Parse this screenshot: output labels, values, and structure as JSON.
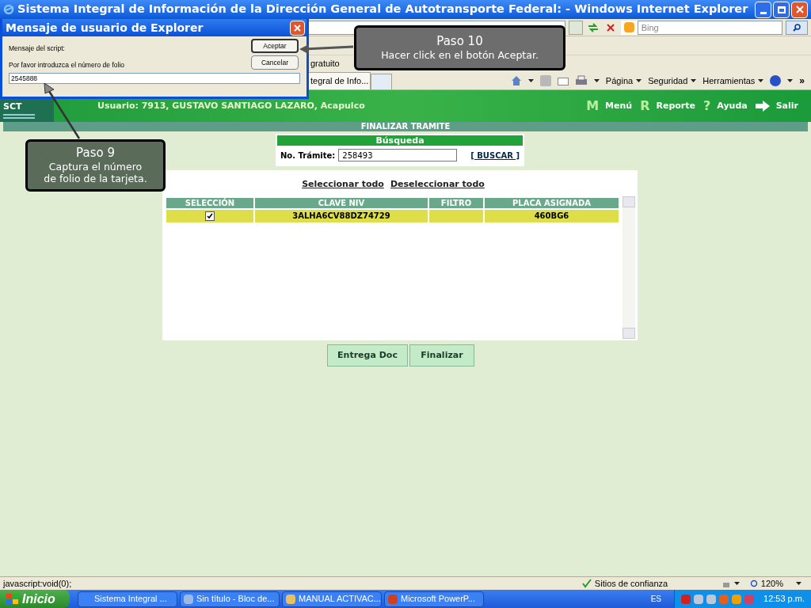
{
  "window": {
    "title": "Sistema Integral de Información de la Dirección General de Autotransporte Federal: - Windows Internet Explorer"
  },
  "search": {
    "placeholder": "Bing"
  },
  "favorites": {
    "item": "gratuito"
  },
  "tab": {
    "label": "tegral de Info..."
  },
  "command_bar": {
    "items": [
      "Página",
      "Seguridad",
      "Herramientas"
    ],
    "overflow": "»"
  },
  "header": {
    "logo": "SCT",
    "user": "Usuario: 7913, GUSTAVO SANTIAGO LAZARO, Acapulco",
    "menu": [
      {
        "kind": "letter",
        "key": "M",
        "label": "Menú"
      },
      {
        "kind": "letter",
        "key": "R",
        "label": "Reporte"
      },
      {
        "kind": "letter",
        "key": "?",
        "label": "Ayuda"
      },
      {
        "kind": "arrow",
        "label": "Salir"
      }
    ]
  },
  "section_title": "FINALIZAR TRAMITE",
  "search_box": {
    "title": "Búsqueda",
    "label": "No. Trámite:",
    "value": "258493",
    "button": "[ BUSCAR ]"
  },
  "links": [
    "Seleccionar todo",
    "Deseleccionar todo"
  ],
  "table": {
    "columns": [
      "SELECCIÓN",
      "CLAVE NIV",
      "FILTRO",
      "PLACA ASIGNADA"
    ],
    "rows": [
      {
        "checked": true,
        "clave_niv": "3ALHA6CV88DZ74729",
        "placa_asignada": "460BG6"
      }
    ]
  },
  "buttons": [
    "Entrega Doc",
    "Finalizar"
  ],
  "dialog": {
    "title": "Mensaje de usuario de Explorer",
    "label": "Mensaje del script:",
    "message": "Por favor introduzca el número de folio",
    "value": "2545888",
    "buttons": [
      "Aceptar",
      "Cancelar"
    ]
  },
  "callouts": [
    {
      "title": "Paso 10",
      "lines": [
        "Hacer click en el botón Aceptar."
      ]
    },
    {
      "title": "Paso 9",
      "lines": [
        "Captura el número",
        "de folio de la tarjeta."
      ]
    }
  ],
  "status_bar": {
    "text": "javascript:void(0);",
    "zone": "Sitios de confianza",
    "zoom": "120%"
  },
  "taskbar": {
    "start": "Inicio",
    "tasks": [
      "Sistema Integral ...",
      "Sin título - Bloc de...",
      "MANUAL ACTIVAC...",
      "Microsoft PowerP..."
    ],
    "language": "ES",
    "clock": "12:53 p.m."
  }
}
